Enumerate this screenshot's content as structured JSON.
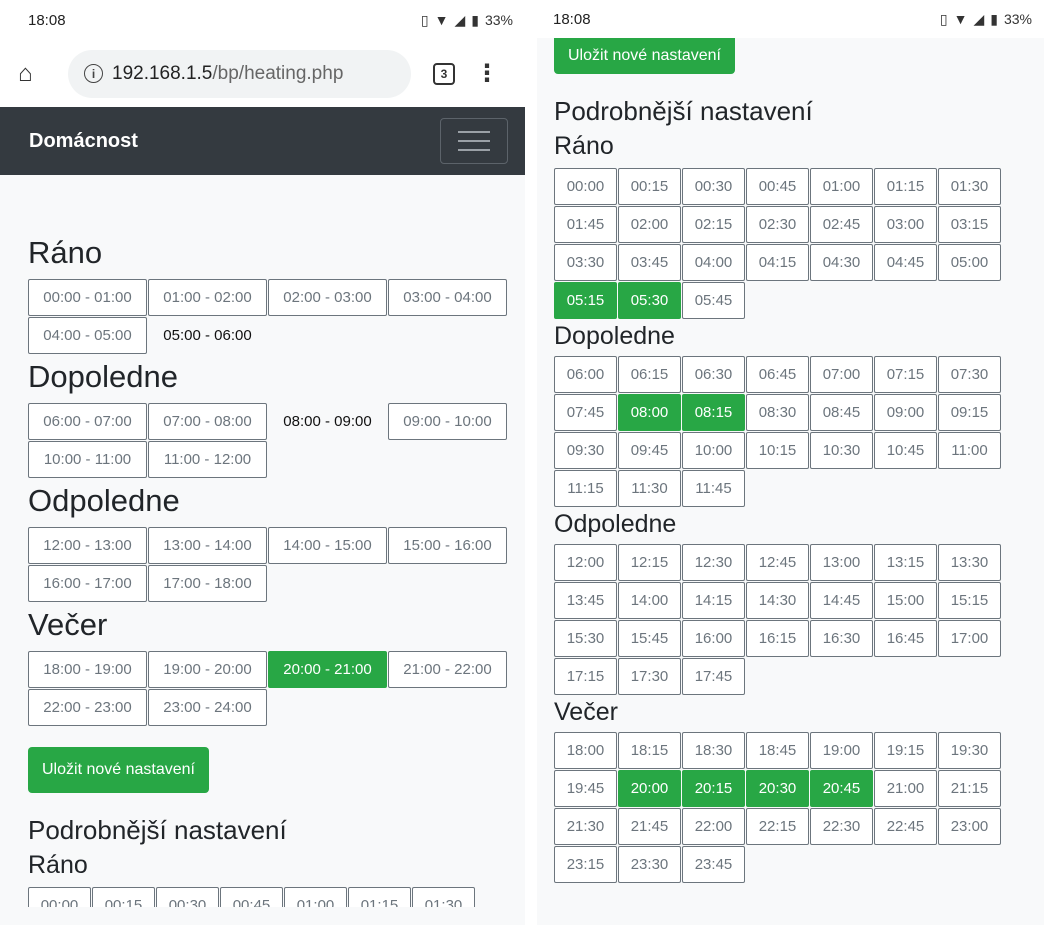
{
  "status": {
    "time": "18:08",
    "battery": "33%"
  },
  "browser": {
    "url_host": "192.168.1.5",
    "url_path": "/bp/heating.php",
    "tab_count": "3"
  },
  "navbar": {
    "brand": "Domácnost"
  },
  "hourly": {
    "groups": [
      {
        "title": "Ráno",
        "slots": [
          {
            "label": "00:00 - 01:00",
            "state": "off"
          },
          {
            "label": "01:00 - 02:00",
            "state": "off"
          },
          {
            "label": "02:00 - 03:00",
            "state": "off"
          },
          {
            "label": "03:00 - 04:00",
            "state": "off"
          },
          {
            "label": "04:00 - 05:00",
            "state": "off"
          },
          {
            "label": "05:00 - 06:00",
            "state": "partial"
          }
        ]
      },
      {
        "title": "Dopoledne",
        "slots": [
          {
            "label": "06:00 - 07:00",
            "state": "off"
          },
          {
            "label": "07:00 - 08:00",
            "state": "off"
          },
          {
            "label": "08:00 - 09:00",
            "state": "partial"
          },
          {
            "label": "09:00 - 10:00",
            "state": "off"
          },
          {
            "label": "10:00 - 11:00",
            "state": "off"
          },
          {
            "label": "11:00 - 12:00",
            "state": "off"
          }
        ]
      },
      {
        "title": "Odpoledne",
        "slots": [
          {
            "label": "12:00 - 13:00",
            "state": "off"
          },
          {
            "label": "13:00 - 14:00",
            "state": "off"
          },
          {
            "label": "14:00 - 15:00",
            "state": "off"
          },
          {
            "label": "15:00 - 16:00",
            "state": "off"
          },
          {
            "label": "16:00 - 17:00",
            "state": "off"
          },
          {
            "label": "17:00 - 18:00",
            "state": "off"
          }
        ]
      },
      {
        "title": "Večer",
        "slots": [
          {
            "label": "18:00 - 19:00",
            "state": "off"
          },
          {
            "label": "19:00 - 20:00",
            "state": "off"
          },
          {
            "label": "20:00 - 21:00",
            "state": "on"
          },
          {
            "label": "21:00 - 22:00",
            "state": "off"
          },
          {
            "label": "22:00 - 23:00",
            "state": "off"
          },
          {
            "label": "23:00 - 24:00",
            "state": "off"
          }
        ]
      }
    ]
  },
  "save_label": "Uložit nové nastavení",
  "detail_title": "Podrobnější nastavení",
  "quarter": {
    "groups": [
      {
        "title": "Ráno",
        "slots": [
          {
            "label": "00:00",
            "state": "off"
          },
          {
            "label": "00:15",
            "state": "off"
          },
          {
            "label": "00:30",
            "state": "off"
          },
          {
            "label": "00:45",
            "state": "off"
          },
          {
            "label": "01:00",
            "state": "off"
          },
          {
            "label": "01:15",
            "state": "off"
          },
          {
            "label": "01:30",
            "state": "off"
          },
          {
            "label": "01:45",
            "state": "off"
          },
          {
            "label": "02:00",
            "state": "off"
          },
          {
            "label": "02:15",
            "state": "off"
          },
          {
            "label": "02:30",
            "state": "off"
          },
          {
            "label": "02:45",
            "state": "off"
          },
          {
            "label": "03:00",
            "state": "off"
          },
          {
            "label": "03:15",
            "state": "off"
          },
          {
            "label": "03:30",
            "state": "off"
          },
          {
            "label": "03:45",
            "state": "off"
          },
          {
            "label": "04:00",
            "state": "off"
          },
          {
            "label": "04:15",
            "state": "off"
          },
          {
            "label": "04:30",
            "state": "off"
          },
          {
            "label": "04:45",
            "state": "off"
          },
          {
            "label": "05:00",
            "state": "off"
          },
          {
            "label": "05:15",
            "state": "on"
          },
          {
            "label": "05:30",
            "state": "on"
          },
          {
            "label": "05:45",
            "state": "off"
          }
        ]
      },
      {
        "title": "Dopoledne",
        "slots": [
          {
            "label": "06:00",
            "state": "off"
          },
          {
            "label": "06:15",
            "state": "off"
          },
          {
            "label": "06:30",
            "state": "off"
          },
          {
            "label": "06:45",
            "state": "off"
          },
          {
            "label": "07:00",
            "state": "off"
          },
          {
            "label": "07:15",
            "state": "off"
          },
          {
            "label": "07:30",
            "state": "off"
          },
          {
            "label": "07:45",
            "state": "off"
          },
          {
            "label": "08:00",
            "state": "on"
          },
          {
            "label": "08:15",
            "state": "on"
          },
          {
            "label": "08:30",
            "state": "off"
          },
          {
            "label": "08:45",
            "state": "off"
          },
          {
            "label": "09:00",
            "state": "off"
          },
          {
            "label": "09:15",
            "state": "off"
          },
          {
            "label": "09:30",
            "state": "off"
          },
          {
            "label": "09:45",
            "state": "off"
          },
          {
            "label": "10:00",
            "state": "off"
          },
          {
            "label": "10:15",
            "state": "off"
          },
          {
            "label": "10:30",
            "state": "off"
          },
          {
            "label": "10:45",
            "state": "off"
          },
          {
            "label": "11:00",
            "state": "off"
          },
          {
            "label": "11:15",
            "state": "off"
          },
          {
            "label": "11:30",
            "state": "off"
          },
          {
            "label": "11:45",
            "state": "off"
          }
        ]
      },
      {
        "title": "Odpoledne",
        "slots": [
          {
            "label": "12:00",
            "state": "off"
          },
          {
            "label": "12:15",
            "state": "off"
          },
          {
            "label": "12:30",
            "state": "off"
          },
          {
            "label": "12:45",
            "state": "off"
          },
          {
            "label": "13:00",
            "state": "off"
          },
          {
            "label": "13:15",
            "state": "off"
          },
          {
            "label": "13:30",
            "state": "off"
          },
          {
            "label": "13:45",
            "state": "off"
          },
          {
            "label": "14:00",
            "state": "off"
          },
          {
            "label": "14:15",
            "state": "off"
          },
          {
            "label": "14:30",
            "state": "off"
          },
          {
            "label": "14:45",
            "state": "off"
          },
          {
            "label": "15:00",
            "state": "off"
          },
          {
            "label": "15:15",
            "state": "off"
          },
          {
            "label": "15:30",
            "state": "off"
          },
          {
            "label": "15:45",
            "state": "off"
          },
          {
            "label": "16:00",
            "state": "off"
          },
          {
            "label": "16:15",
            "state": "off"
          },
          {
            "label": "16:30",
            "state": "off"
          },
          {
            "label": "16:45",
            "state": "off"
          },
          {
            "label": "17:00",
            "state": "off"
          },
          {
            "label": "17:15",
            "state": "off"
          },
          {
            "label": "17:30",
            "state": "off"
          },
          {
            "label": "17:45",
            "state": "off"
          }
        ]
      },
      {
        "title": "Večer",
        "slots": [
          {
            "label": "18:00",
            "state": "off"
          },
          {
            "label": "18:15",
            "state": "off"
          },
          {
            "label": "18:30",
            "state": "off"
          },
          {
            "label": "18:45",
            "state": "off"
          },
          {
            "label": "19:00",
            "state": "off"
          },
          {
            "label": "19:15",
            "state": "off"
          },
          {
            "label": "19:30",
            "state": "off"
          },
          {
            "label": "19:45",
            "state": "off"
          },
          {
            "label": "20:00",
            "state": "on"
          },
          {
            "label": "20:15",
            "state": "on"
          },
          {
            "label": "20:30",
            "state": "on"
          },
          {
            "label": "20:45",
            "state": "on"
          },
          {
            "label": "21:00",
            "state": "off"
          },
          {
            "label": "21:15",
            "state": "off"
          },
          {
            "label": "21:30",
            "state": "off"
          },
          {
            "label": "21:45",
            "state": "off"
          },
          {
            "label": "22:00",
            "state": "off"
          },
          {
            "label": "22:15",
            "state": "off"
          },
          {
            "label": "22:30",
            "state": "off"
          },
          {
            "label": "22:45",
            "state": "off"
          },
          {
            "label": "23:00",
            "state": "off"
          },
          {
            "label": "23:15",
            "state": "off"
          },
          {
            "label": "23:30",
            "state": "off"
          },
          {
            "label": "23:45",
            "state": "off"
          }
        ]
      }
    ]
  },
  "colors": {
    "active": "#28a745",
    "navbar": "#343a40",
    "border": "#6c757d"
  }
}
